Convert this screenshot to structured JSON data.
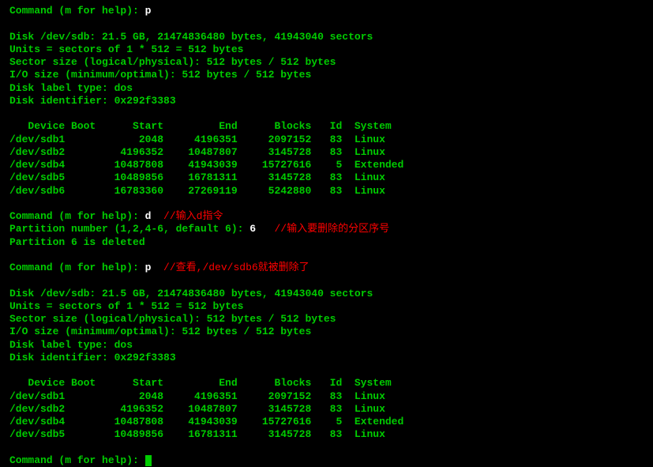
{
  "session": {
    "prompt_label": "Command (m for help): ",
    "cmd1": "p",
    "cmd2": "d",
    "cmd3": "p",
    "partition_prompt": "Partition number (1,2,4-6, default 6): ",
    "partition_input": "6",
    "deleted_msg": "Partition 6 is deleted"
  },
  "disk_info": {
    "line1": "Disk /dev/sdb: 21.5 GB, 21474836480 bytes, 41943040 sectors",
    "line2": "Units = sectors of 1 * 512 = 512 bytes",
    "line3": "Sector size (logical/physical): 512 bytes / 512 bytes",
    "line4": "I/O size (minimum/optimal): 512 bytes / 512 bytes",
    "line5": "Disk label type: dos",
    "line6": "Disk identifier: 0x292f3383"
  },
  "table1": {
    "header": "   Device Boot      Start         End      Blocks   Id  System",
    "rows": [
      "/dev/sdb1            2048     4196351     2097152   83  Linux",
      "/dev/sdb2         4196352    10487807     3145728   83  Linux",
      "/dev/sdb4        10487808    41943039    15727616    5  Extended",
      "/dev/sdb5        10489856    16781311     3145728   83  Linux",
      "/dev/sdb6        16783360    27269119     5242880   83  Linux"
    ]
  },
  "table2": {
    "header": "   Device Boot      Start         End      Blocks   Id  System",
    "rows": [
      "/dev/sdb1            2048     4196351     2097152   83  Linux",
      "/dev/sdb2         4196352    10487807     3145728   83  Linux",
      "/dev/sdb4        10487808    41943039    15727616    5  Extended",
      "/dev/sdb5        10489856    16781311     3145728   83  Linux"
    ]
  },
  "annotations": {
    "a1": "  //输入d指令",
    "a2": "   //输入要删除的分区序号",
    "a3": "  //查看,/dev/sdb6就被删除了"
  }
}
